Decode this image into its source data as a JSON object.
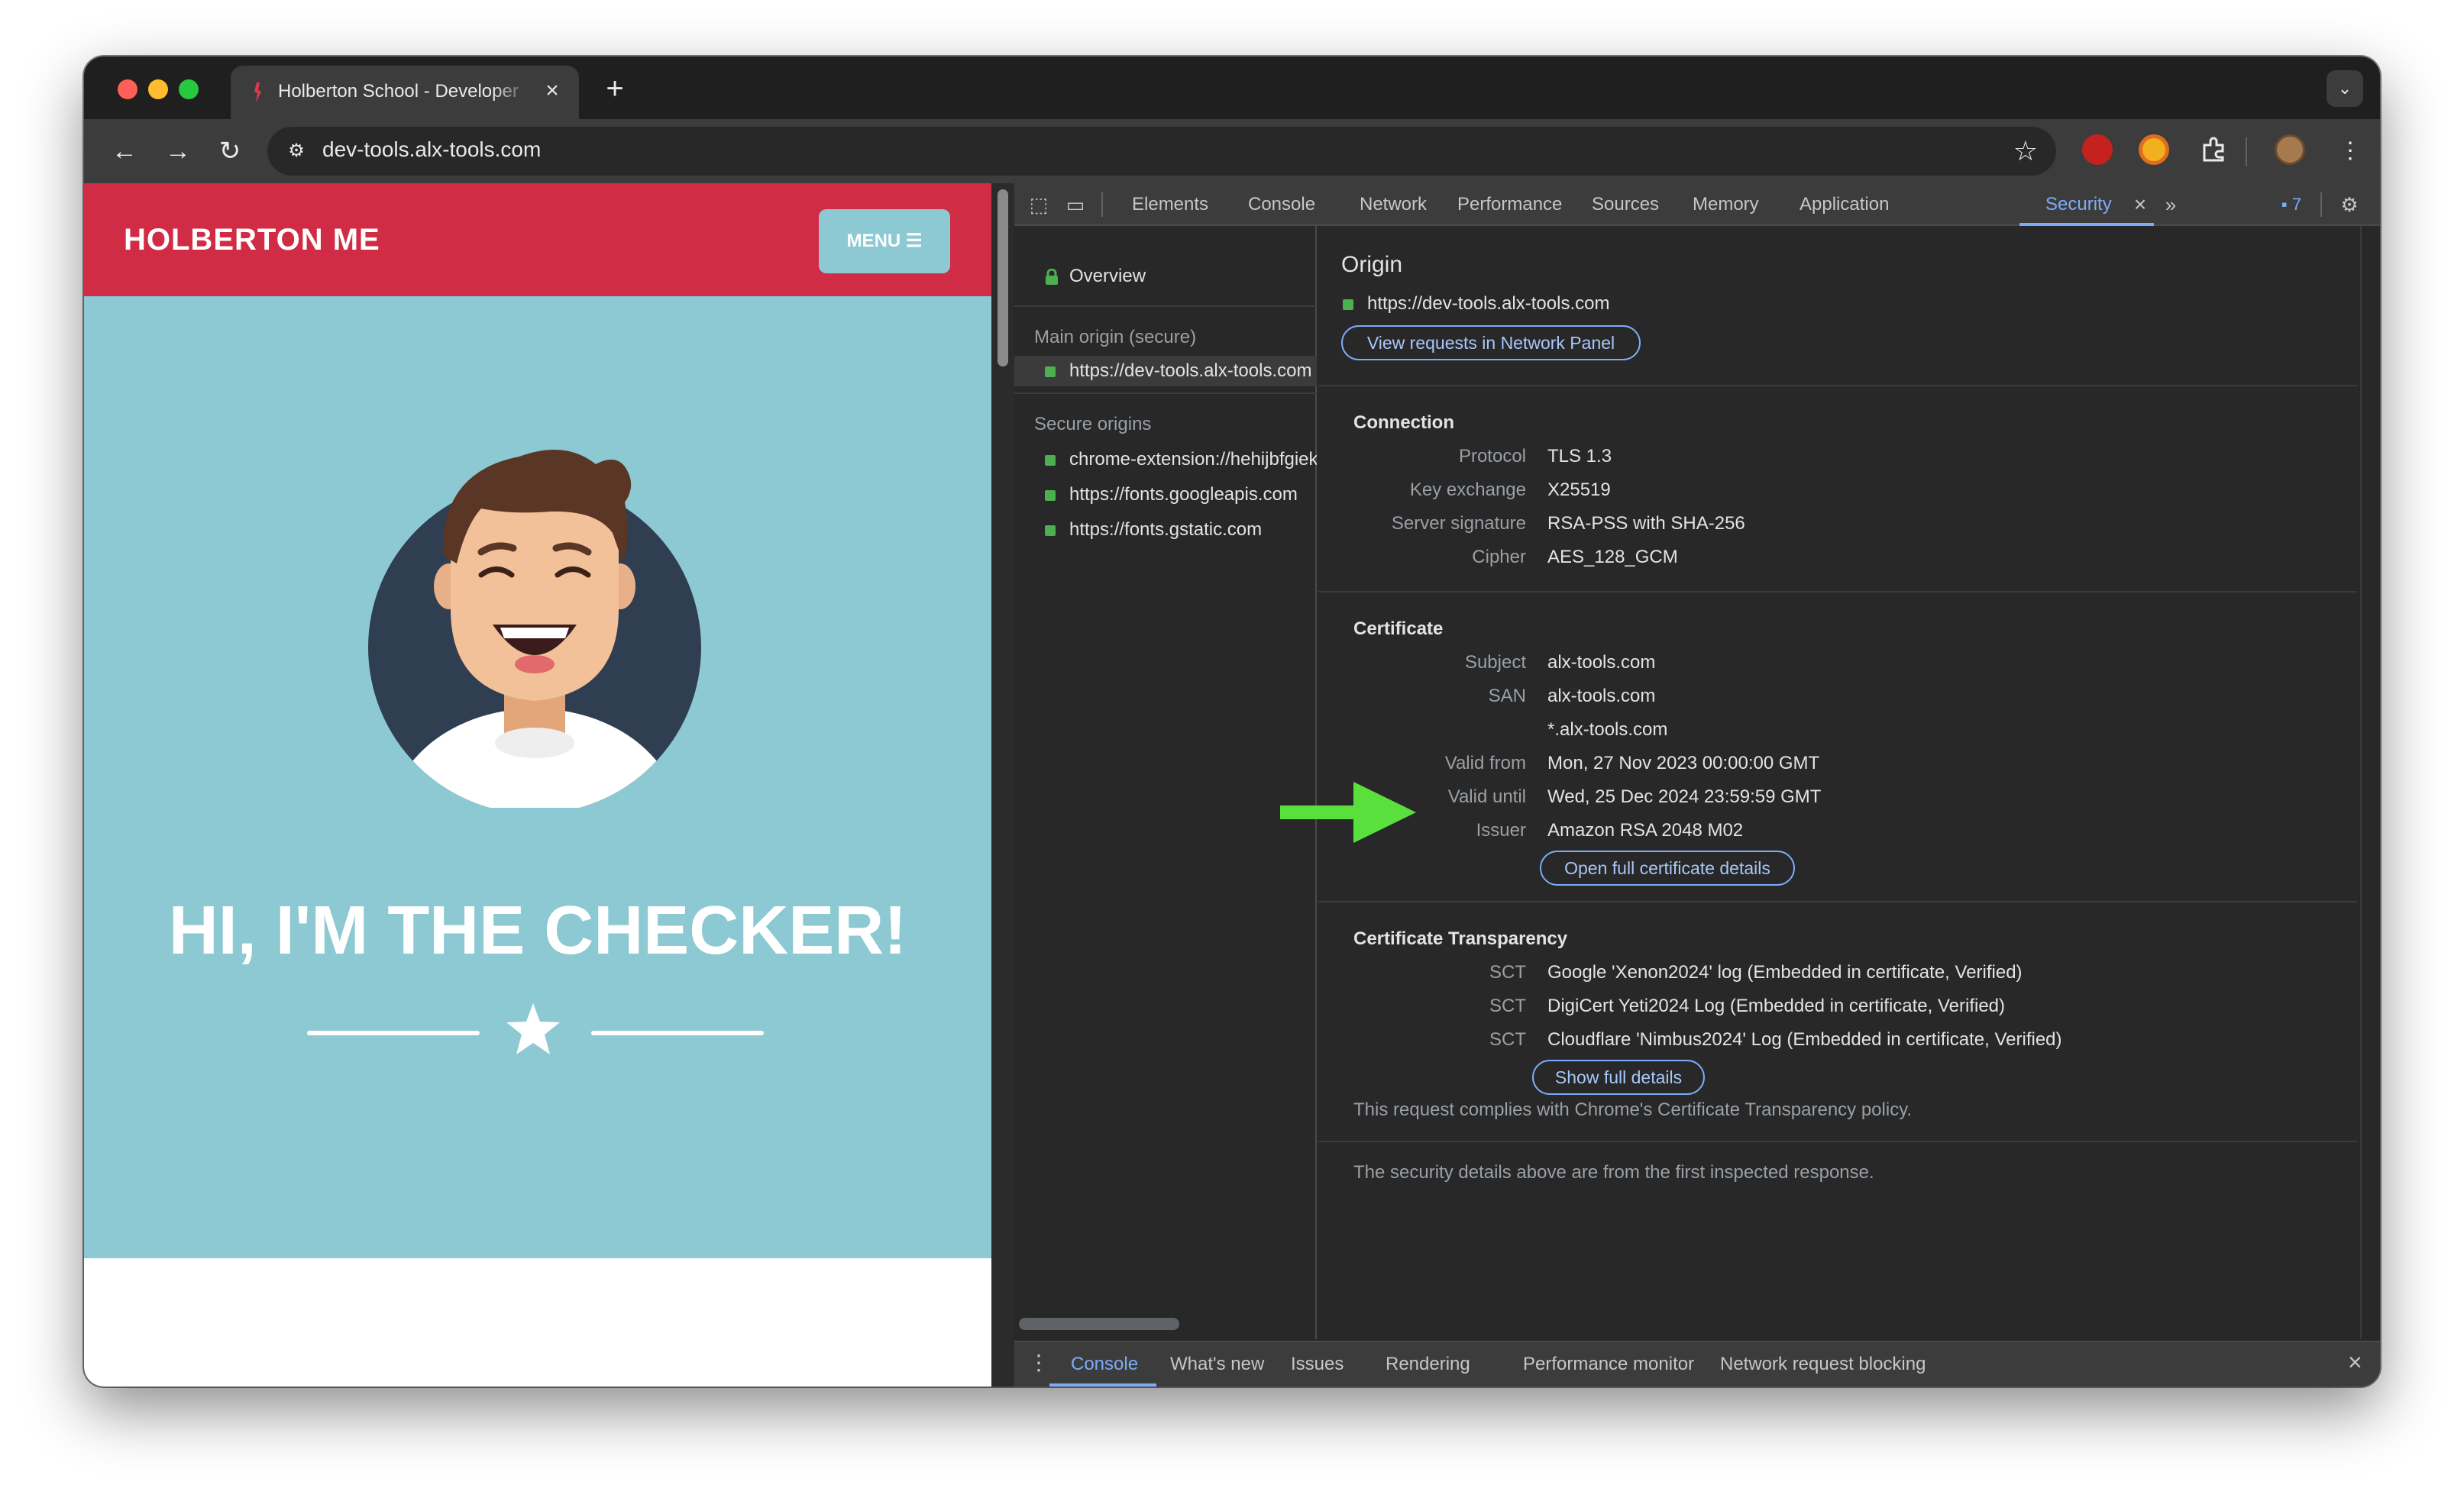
{
  "browser": {
    "tab_title": "Holberton School - Developer",
    "tab_close": "×",
    "new_tab": "+",
    "tab_search": "⌄",
    "address": "dev-tools.alx-tools.com",
    "nav": {
      "back": "←",
      "forward": "→",
      "reload": "↻"
    },
    "icons": [
      "tune-icon",
      "star-icon",
      "ublock-icon",
      "cookie-extension-icon",
      "puzzle-icon",
      "profile-avatar",
      "kebab-menu-icon"
    ]
  },
  "website": {
    "logo": "HOLBERTON ME",
    "menu_button": "MENU ☰",
    "hero_title": "HI, I'M THE CHECKER!",
    "colors": {
      "header": "#d12c46",
      "hero": "#8dc9d3"
    }
  },
  "devtools": {
    "tabs": [
      "Elements",
      "Console",
      "Network",
      "Performance",
      "Sources",
      "Memory",
      "Application",
      "Security"
    ],
    "active_tab": "Security",
    "more_tabs": "»",
    "issues_count": "7",
    "sidebar": {
      "overview": "Overview",
      "main_origin_heading": "Main origin (secure)",
      "main_origin": "https://dev-tools.alx-tools.com",
      "secure_origins_heading": "Secure origins",
      "secure_origins": [
        "chrome-extension://hehijbfgiekmjfkfjpbkbammjbdenadd",
        "https://fonts.googleapis.com",
        "https://fonts.gstatic.com"
      ]
    },
    "origin": {
      "title": "Origin",
      "url": "https://dev-tools.alx-tools.com",
      "view_requests_button": "View requests in Network Panel"
    },
    "connection": {
      "title": "Connection",
      "rows": [
        {
          "label": "Protocol",
          "value": "TLS 1.3"
        },
        {
          "label": "Key exchange",
          "value": "X25519"
        },
        {
          "label": "Server signature",
          "value": "RSA-PSS with SHA-256"
        },
        {
          "label": "Cipher",
          "value": "AES_128_GCM"
        }
      ]
    },
    "certificate": {
      "title": "Certificate",
      "rows": [
        {
          "label": "Subject",
          "value": "alx-tools.com"
        },
        {
          "label": "SAN",
          "value": "alx-tools.com"
        },
        {
          "label": "",
          "value": "*.alx-tools.com"
        },
        {
          "label": "Valid from",
          "value": "Mon, 27 Nov 2023 00:00:00 GMT"
        },
        {
          "label": "Valid until",
          "value": "Wed, 25 Dec 2024 23:59:59 GMT"
        },
        {
          "label": "Issuer",
          "value": "Amazon RSA 2048 M02"
        }
      ],
      "open_details_button": "Open full certificate details"
    },
    "transparency": {
      "title": "Certificate Transparency",
      "rows": [
        {
          "label": "SCT",
          "value": "Google 'Xenon2024' log (Embedded in certificate, Verified)"
        },
        {
          "label": "SCT",
          "value": "DigiCert Yeti2024 Log (Embedded in certificate, Verified)"
        },
        {
          "label": "SCT",
          "value": "Cloudflare 'Nimbus2024' Log (Embedded in certificate, Verified)"
        }
      ],
      "show_details_button": "Show full details",
      "policy": "This request complies with Chrome's Certificate Transparency policy."
    },
    "footnote": "The security details above are from the first inspected response.",
    "drawer": {
      "tabs": [
        "Console",
        "What's new",
        "Issues",
        "Rendering",
        "Performance monitor",
        "Network request blocking"
      ],
      "active_tab": "Console",
      "close": "×"
    },
    "colors": {
      "accent": "#7cacf8",
      "secure_green": "#4caf50",
      "annotation_arrow": "#5ae03c"
    }
  }
}
